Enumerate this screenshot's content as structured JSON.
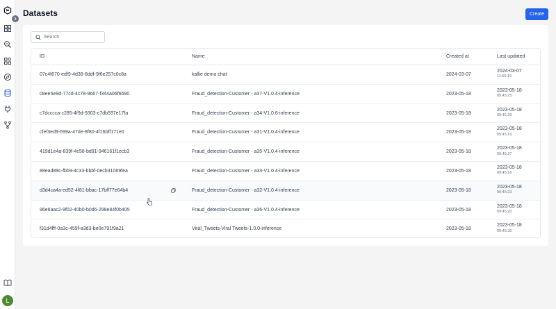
{
  "header": {
    "title": "Datasets",
    "create_label": "Create"
  },
  "search": {
    "placeholder": "Search",
    "value": ""
  },
  "table": {
    "columns": {
      "id": "ID",
      "name": "Name",
      "created": "Created at",
      "updated": "Last updated"
    },
    "rows": [
      {
        "id": "07c4f670-edf9-4d38-8ddf-9f6e257c0c8a",
        "name": "kallie demo chat",
        "created": "2024-03-07",
        "updated_date": "2024-03-07",
        "updated_time": "11:50:19"
      },
      {
        "id": "08ee5e9d-77cd-4c78-9667-f344a06f6690",
        "name": "Fraud_detection-Customer - a37-V1.0.4-inference",
        "created": "2023-05-18",
        "updated_date": "2023-05-18",
        "updated_time": "09:45:25"
      },
      {
        "id": "c7dcccca-c285-4f9d-9303-c7db597e17fa",
        "name": "Fraud_detection-Customer - a34-V1.0.6-inference",
        "created": "2023-05-18",
        "updated_date": "2023-05-18",
        "updated_time": "09:45:29"
      },
      {
        "id": "cfef3ed9-699a-47de-8f80-4f16bff171e0",
        "name": "Fraud_detection-Customer - a31-V1.0.4-inference",
        "created": "2023-05-18",
        "updated_date": "2023-05-18",
        "updated_time": "09:45:16"
      },
      {
        "id": "419d1e4a-839f-4c58-bd91-946161f1ecb3",
        "name": "Fraud_detection-Customer - a35-V1.0.4-inference",
        "created": "2023-05-18",
        "updated_date": "2023-05-18",
        "updated_time": "09:45:27"
      },
      {
        "id": "88ead89c-fbb9-4c33-bbbf-0ecb31069fea",
        "name": "Fraud_detection-Customer - a33-V1.0.4-inference",
        "created": "2023-05-18",
        "updated_date": "2023-05-18",
        "updated_time": "09:45:16"
      },
      {
        "id": "d3d4ca4a-ed52-4f81-bbac-17bff77e64b4",
        "name": "Fraud_detection-Customer - a32-V1.0.4-inference",
        "created": "2023-05-18",
        "updated_date": "2023-05-18",
        "updated_time": "09:45:23"
      },
      {
        "id": "96e6aac2-9f02-40b0-b0d6-298e84f0b405",
        "name": "Fraud_detection-Customer - a36-V1.0.4-inference",
        "created": "2023-05-18",
        "updated_date": "2023-05-18",
        "updated_time": "09:45:20"
      },
      {
        "id": "f31d4fff-0a3c-459f-a3d3-be0e791f9a21",
        "name": "Viral_Tweets-Viral Tweets-1.0.0-inference",
        "created": "2023-05-18",
        "updated_date": "2023-05-18",
        "updated_time": "09:45:32"
      }
    ]
  },
  "user": {
    "avatar_initial": "L"
  },
  "icons": {
    "logo": "app-logo-icon",
    "expand": "chevron-right-icon",
    "nav": [
      "dashboard-icon",
      "search-zoom-icon",
      "apps-icon",
      "compass-icon",
      "database-icon",
      "plug-icon",
      "branch-icon",
      "book-icon"
    ],
    "copy": "copy-icon",
    "cursor": "pointer-cursor-icon"
  },
  "colors": {
    "accent": "#2563eb",
    "active_nav": "#2563eb",
    "avatar": "#4d8a2f"
  }
}
